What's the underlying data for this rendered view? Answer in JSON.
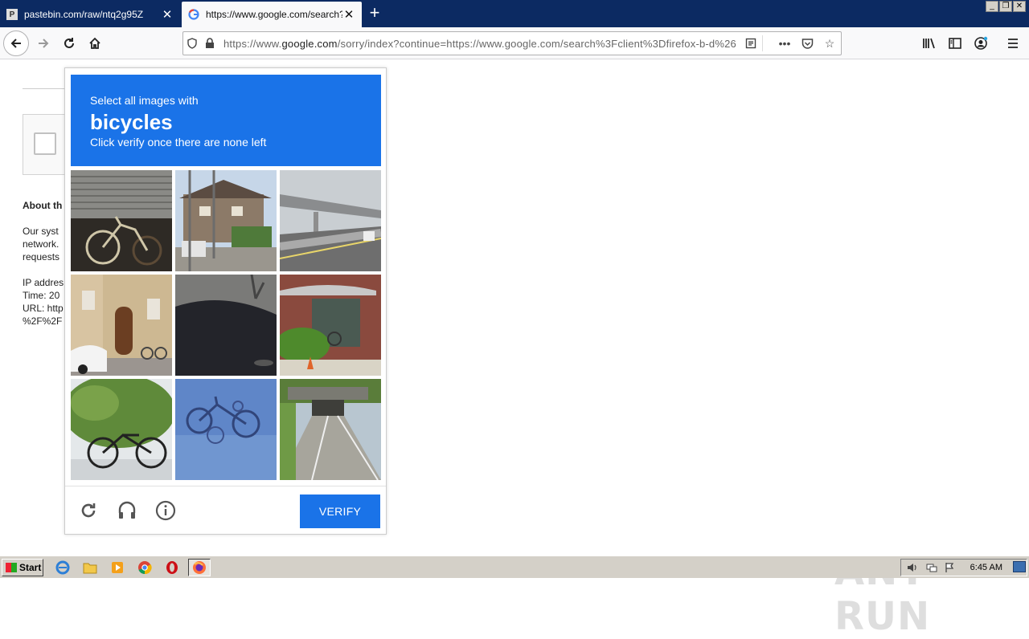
{
  "browser": {
    "tabs": [
      {
        "title": "pastebin.com/raw/ntq2g95Z"
      },
      {
        "title": "https://www.google.com/search?c"
      }
    ],
    "url_prefix": "https://www.",
    "url_domain": "google.com",
    "url_rest": "/sorry/index?continue=https://www.google.com/search%3Fclient%3Dfirefox-b-d%26"
  },
  "page": {
    "about_heading": "About th",
    "paragraph_lines": [
      "Our syst",
      "network.",
      "requests"
    ],
    "info_lines": [
      "IP addres",
      "Time: 20",
      "URL: http",
      "%2F%2F"
    ]
  },
  "captcha": {
    "instruction": "Select all images with",
    "target": "bicycles",
    "hint": "Click verify once there are none left",
    "verify_label": "VERIFY"
  },
  "watermark": "ANY RUN",
  "taskbar": {
    "start_label": "Start",
    "clock": "6:45 AM"
  },
  "colors": {
    "captcha_blue": "#1a73e8",
    "tabbar": "#0c2a62"
  }
}
